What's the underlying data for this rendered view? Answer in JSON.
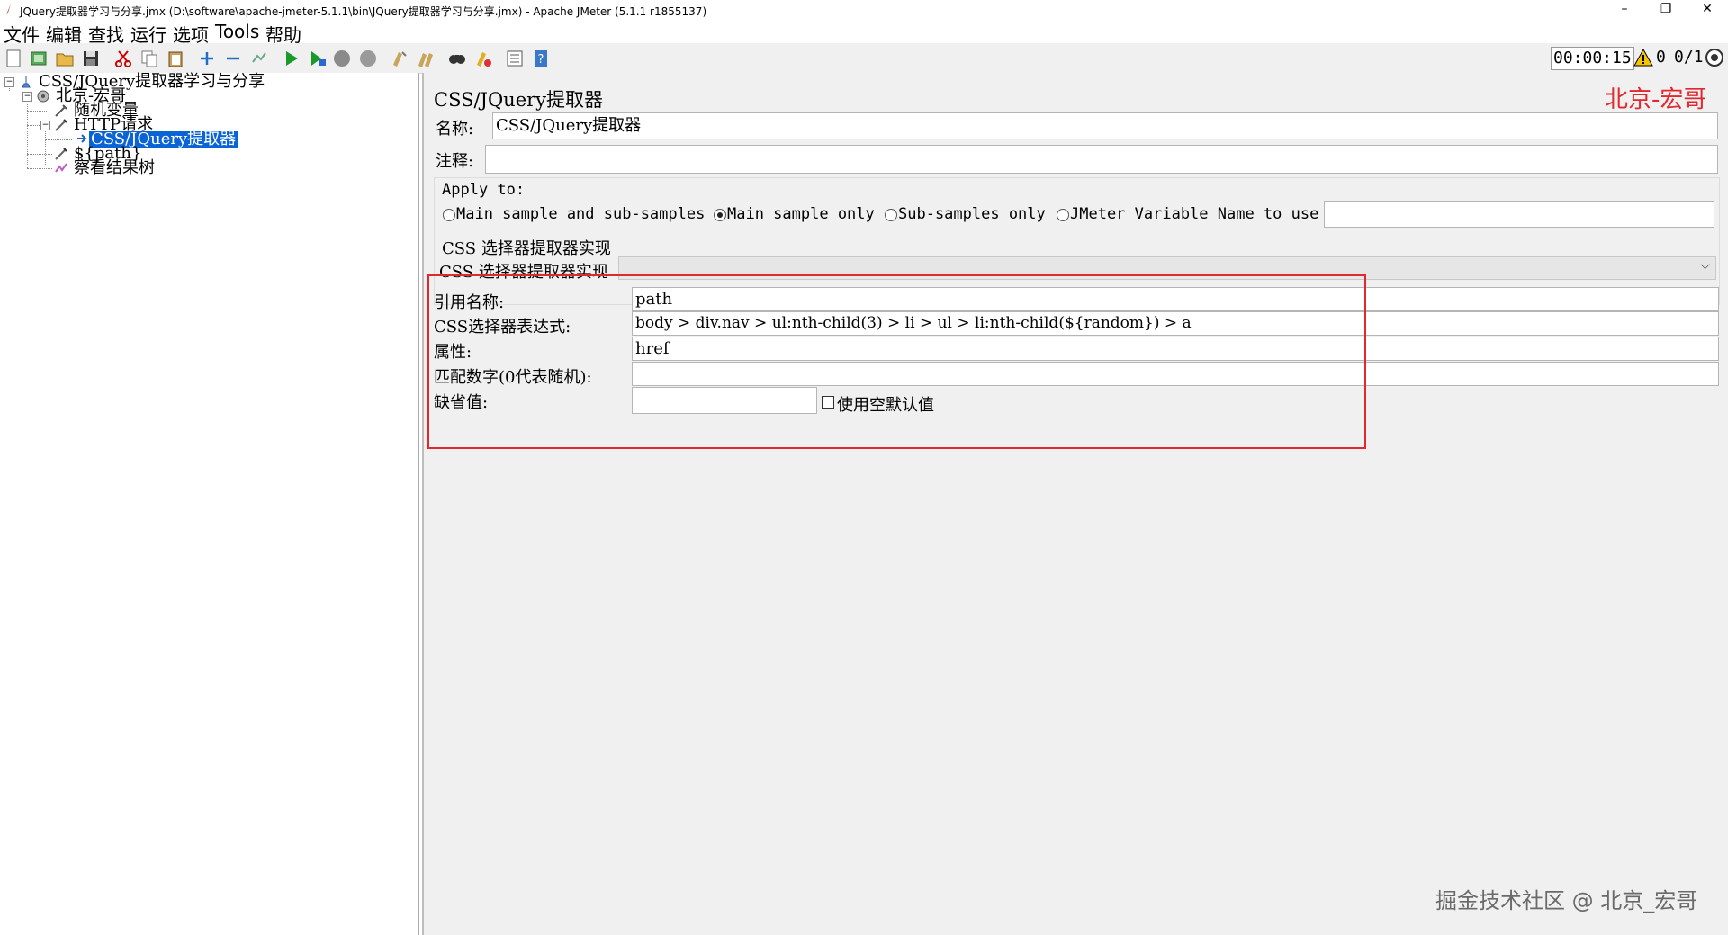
{
  "window": {
    "title": "JQuery提取器学习与分享.jmx (D:\\software\\apache-jmeter-5.1.1\\bin\\JQuery提取器学习与分享.jmx) - Apache JMeter (5.1.1 r1855137)",
    "minimize": "–",
    "restore": "❐",
    "close": "✕"
  },
  "menu": [
    "文件",
    "编辑",
    "查找",
    "运行",
    "选项",
    "Tools",
    "帮助"
  ],
  "status": {
    "timer": "00:00:15",
    "warnings": "0",
    "threads": "0/1"
  },
  "tree": {
    "items": [
      {
        "label": "CSS/JQuery提取器学习与分享",
        "icon": "test-plan-icon"
      },
      {
        "label": "北京-宏哥",
        "icon": "thread-group-icon"
      },
      {
        "label": "随机变量",
        "icon": "config-element-icon"
      },
      {
        "label": "HTTP请求",
        "icon": "sampler-icon"
      },
      {
        "label": "CSS/JQuery提取器",
        "icon": "post-processor-icon"
      },
      {
        "label": "${path}",
        "icon": "sampler-icon"
      },
      {
        "label": "察看结果树",
        "icon": "listener-icon"
      }
    ]
  },
  "panel": {
    "title": "CSS/JQuery提取器",
    "watermark_top": "北京-宏哥",
    "name_label": "名称:",
    "name_value": "CSS/JQuery提取器",
    "comment_label": "注释:",
    "comment_value": "",
    "apply_to": {
      "label": "Apply to:",
      "options": [
        "Main sample and sub-samples",
        "Main sample only",
        "Sub-samples only",
        "JMeter Variable Name to use"
      ],
      "selected": "Main sample only",
      "variable_value": ""
    },
    "impl": {
      "group_label": "CSS 选择器提取器实现",
      "select_label": "CSS 选择器提取器实现",
      "select_value": ""
    },
    "fields": {
      "ref_name_label": "引用名称:",
      "ref_name_value": "path",
      "expr_label": "CSS选择器表达式:",
      "expr_value": "body > div.nav > ul:nth-child(3) > li > ul > li:nth-child(${random}) > a",
      "attr_label": "属性:",
      "attr_value": "href",
      "match_label": "匹配数字(0代表随机):",
      "match_value": "",
      "default_label": "缺省值:",
      "default_value": "",
      "use_empty_label": "使用空默认值",
      "use_empty_checked": false
    },
    "highlight_color": "#e0282e",
    "watermark_bottom": "掘金技术社区 @ 北京_宏哥"
  }
}
